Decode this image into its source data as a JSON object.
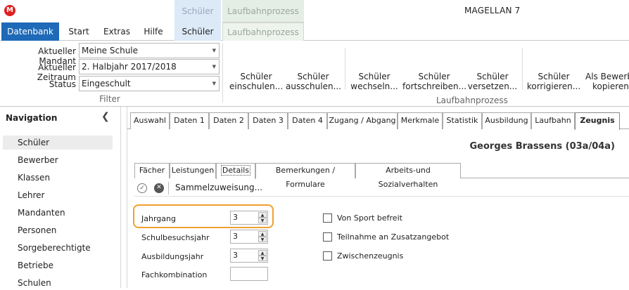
{
  "window": {
    "title": "MAGELLAN 7",
    "logo_letter": "M",
    "context_tabs": [
      "Schüler",
      "Laufbahnprozess"
    ]
  },
  "ribbon": {
    "tabs": [
      "Datenbank",
      "Start",
      "Extras",
      "Hilfe",
      "Schüler",
      "Laufbahnprozess"
    ],
    "filter": {
      "mandant_label": "Aktueller Mandant",
      "mandant_value": "Meine Schule",
      "zeitraum_label": "Aktueller Zeitraum",
      "zeitraum_value": "2. Halbjahr 2017/2018",
      "status_label": "Status",
      "status_value": "Eingeschult",
      "group_label": "Filter"
    },
    "laufbahn": {
      "group_label": "Laufbahnprozess",
      "buttons": [
        [
          "Schüler",
          "einschulen..."
        ],
        [
          "Schüler",
          "ausschulen..."
        ],
        [
          "Schüler",
          "wechseln..."
        ],
        [
          "Schüler",
          "fortschreiben..."
        ],
        [
          "Schüler",
          "versetzen..."
        ],
        [
          "Schüler",
          "korrigieren..."
        ],
        [
          "Als Bewerb",
          "kopieren..."
        ]
      ]
    }
  },
  "nav": {
    "title": "Navigation",
    "collapse_icon": "chevron-left",
    "items": [
      "Schüler",
      "Bewerber",
      "Klassen",
      "Lehrer",
      "Mandanten",
      "Personen",
      "Sorgeberechtigte",
      "Betriebe",
      "Schulen"
    ],
    "active_index": 0
  },
  "main": {
    "tabs": [
      "Auswahl",
      "Daten 1",
      "Daten 2",
      "Daten 3",
      "Daten 4",
      "Zugang / Abgang",
      "Merkmale",
      "Statistik",
      "Ausbildung",
      "Laufbahn",
      "Zeugnis"
    ],
    "active_tab": "Zeugnis",
    "student_name": "Georges Brassens (03a/04a)",
    "sub_tabs": [
      "Fächer",
      "Leistungen",
      "Details",
      "Bemerkungen / Formulare",
      "Arbeits-und Sozialverhalten"
    ],
    "active_sub_tab": "Details",
    "toolbar": {
      "confirm_icon": "check-circle-icon",
      "cancel_icon": "x-circle-icon",
      "label": "Sammelzuweisung..."
    },
    "details": {
      "jahrgang_label": "Jahrgang",
      "jahrgang_value": "3",
      "schulbesuchsjahr_label": "Schulbesuchsjahr",
      "schulbesuchsjahr_value": "3",
      "ausbildungsjahr_label": "Ausbildungsjahr",
      "ausbildungsjahr_value": "3",
      "fachkombination_label": "Fachkombination",
      "fachkombination_value": "",
      "checkboxes": [
        {
          "label": "Von Sport befreit",
          "checked": false
        },
        {
          "label": "Teilnahme an Zusatzangebot",
          "checked": false
        },
        {
          "label": "Zwischenzeugnis",
          "checked": false
        }
      ]
    }
  },
  "colors": {
    "accent_blue": "#1e6ab8",
    "context_schueler": "#dce9f7",
    "context_laufbahn": "#e4eee4",
    "highlight_orange": "#f0a030",
    "logo_red": "#e02020"
  }
}
